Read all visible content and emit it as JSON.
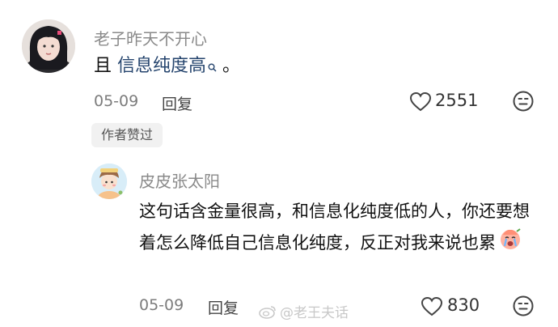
{
  "comment": {
    "username": "老子昨天不开心",
    "text_prefix": "且 ",
    "link_text": "信息纯度高",
    "text_suffix": " 。",
    "date": "05-09",
    "reply_label": "回复",
    "like_count": "2551",
    "author_liked_badge": "作者赞过"
  },
  "reply": {
    "username": "皮皮张太阳",
    "text": "这句话含金量很高，和信息化纯度低的人，你还要想着怎么降低自己信息化纯度，反正对我来说也累",
    "date": "05-09",
    "reply_label": "回复",
    "like_count": "830"
  },
  "watermark": {
    "text": "@老王夫话"
  },
  "colors": {
    "username": "#8a8a8a",
    "link": "#26456e",
    "badge_bg": "#f1f1f1"
  },
  "icons": {
    "like": "heart-outline-icon",
    "more": "face-menu-icon",
    "search": "search-icon",
    "emoji": "crying-face-emoji-icon",
    "watermark_logo": "weibo-logo-icon"
  }
}
